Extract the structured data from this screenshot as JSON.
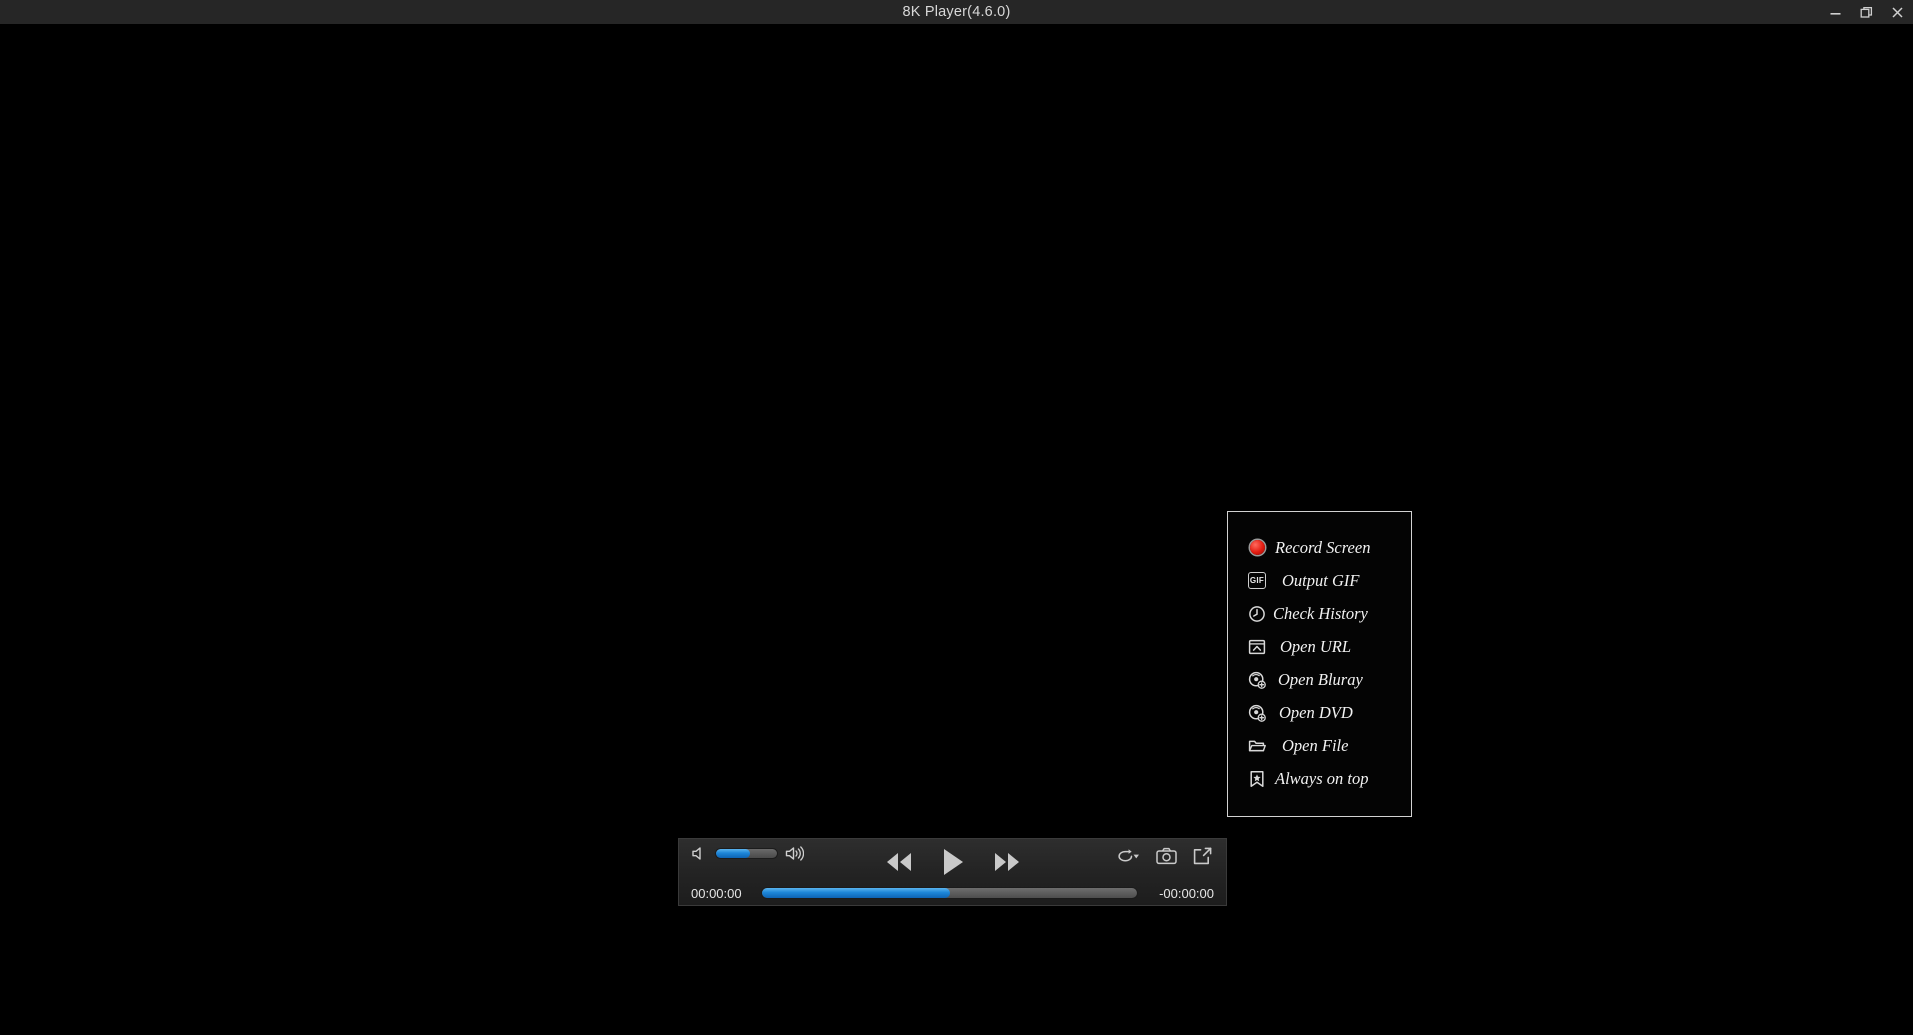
{
  "window": {
    "title": "8K Player(4.6.0)",
    "controls": [
      {
        "name": "minimize-button",
        "icon": "minimize-icon",
        "label": "Minimize"
      },
      {
        "name": "restore-button",
        "icon": "restore-icon",
        "label": "Restore"
      },
      {
        "name": "close-button",
        "icon": "close-icon",
        "label": "Close"
      }
    ]
  },
  "context_menu": {
    "items": [
      {
        "label": "Record Screen",
        "icon": "record-dot-icon"
      },
      {
        "label": "Output GIF",
        "icon": "gif-icon"
      },
      {
        "label": "Check History",
        "icon": "clock-icon"
      },
      {
        "label": "Open URL",
        "icon": "open-url-icon"
      },
      {
        "label": "Open Bluray",
        "icon": "disc-add-icon"
      },
      {
        "label": "Open DVD",
        "icon": "disc-add-icon"
      },
      {
        "label": "Open File",
        "icon": "folder-open-icon"
      },
      {
        "label": "Always on top",
        "icon": "bookmark-star-icon"
      }
    ]
  },
  "player": {
    "volume": {
      "icon_low": "speaker-low-icon",
      "icon_high": "speaker-high-icon",
      "level_percent": 55
    },
    "transport": [
      {
        "name": "rewind-button",
        "icon": "rewind-icon",
        "label": "Rewind"
      },
      {
        "name": "play-button",
        "icon": "play-icon",
        "label": "Play"
      },
      {
        "name": "fast-forward-button",
        "icon": "fast-forward-icon",
        "label": "Fast Forward"
      }
    ],
    "right_icons": [
      {
        "name": "repeat-button",
        "icon": "repeat-dropdown-icon",
        "label": "Repeat"
      },
      {
        "name": "snapshot-button",
        "icon": "camera-icon",
        "label": "Snapshot"
      },
      {
        "name": "export-button",
        "icon": "export-icon",
        "label": "Export"
      }
    ],
    "time_elapsed": "00:00:00",
    "time_remaining": "-00:00:00",
    "progress_percent": 50
  },
  "colors": {
    "accent_blue": "#1d86d8",
    "record_red": "#e21b10",
    "titlebar_bg": "#262626",
    "menu_bg": "#040404",
    "menu_border": "#d2d2d2",
    "video_bg": "#000000"
  }
}
